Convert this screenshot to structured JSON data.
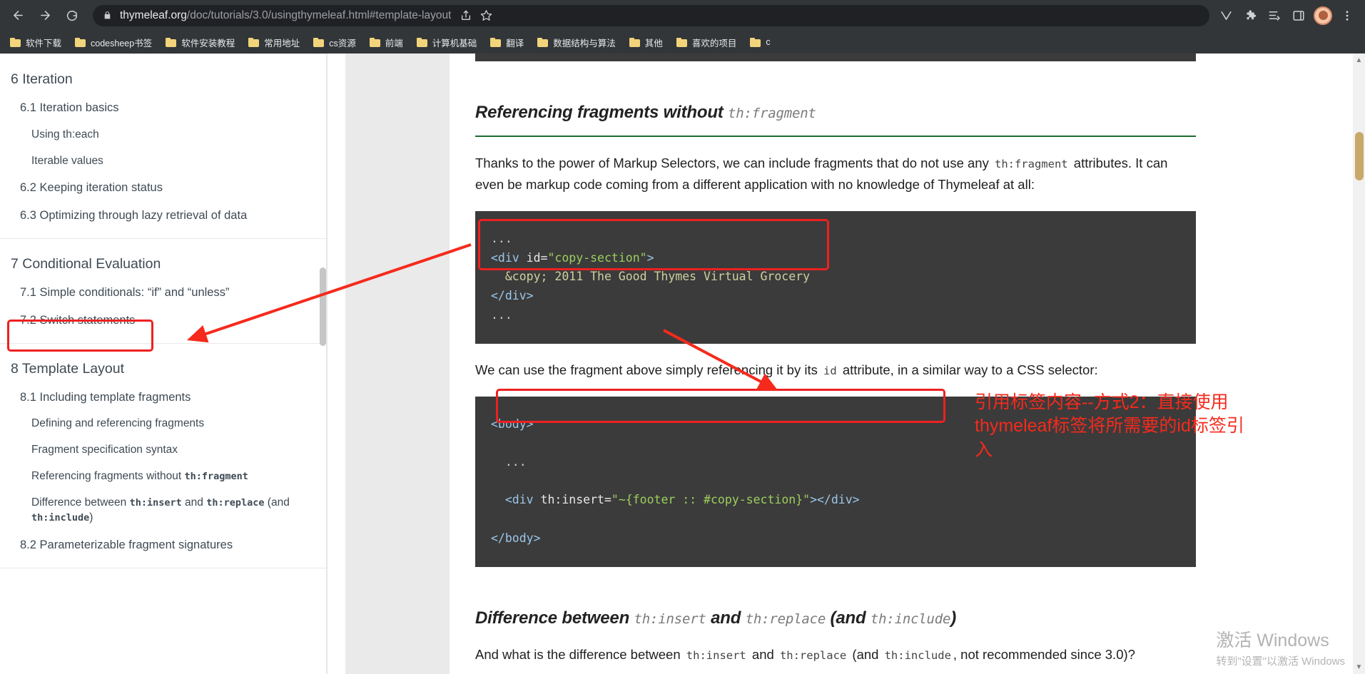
{
  "browser": {
    "back_icon": "back-arrow-icon",
    "forward_icon": "forward-arrow-icon",
    "reload_icon": "reload-icon",
    "lock_icon": "lock-icon",
    "url_host": "thymeleaf.org",
    "url_path": "/doc/tutorials/3.0/usingthymeleaf.html#template-layout",
    "share_icon": "share-icon",
    "bookmark_star_icon": "star-icon",
    "extension_icons": [
      "v-badge-icon",
      "puzzle-extension-icon",
      "reading-list-icon",
      "sidepanel-icon"
    ],
    "menu_icon": "three-dot-menu-icon",
    "avatar": "profile-avatar"
  },
  "bookmarks": [
    {
      "label": "软件下载"
    },
    {
      "label": "codesheep书签"
    },
    {
      "label": "软件安装教程"
    },
    {
      "label": "常用地址"
    },
    {
      "label": "cs资源"
    },
    {
      "label": "前端"
    },
    {
      "label": "计算机基础"
    },
    {
      "label": "翻译"
    },
    {
      "label": "数据结构与算法"
    },
    {
      "label": "其他"
    },
    {
      "label": "喜欢的项目"
    },
    {
      "label": "c"
    }
  ],
  "sidebar": {
    "groups": [
      {
        "items": [
          {
            "label": "6 Iteration",
            "level": 1
          },
          {
            "label": "6.1 Iteration basics",
            "level": 2
          },
          {
            "label": "Using th:each",
            "level": 3
          },
          {
            "label": "Iterable values",
            "level": 3
          },
          {
            "label": "6.2 Keeping iteration status",
            "level": 2
          },
          {
            "label": "6.3 Optimizing through lazy retrieval of data",
            "level": 2
          }
        ]
      },
      {
        "items": [
          {
            "label": "7 Conditional Evaluation",
            "level": 1
          },
          {
            "label": "7.1 Simple conditionals: “if” and “unless”",
            "level": 2
          },
          {
            "label": "7.2 Switch statements",
            "level": 2
          }
        ]
      },
      {
        "items": [
          {
            "label": "8 Template Layout",
            "level": 1,
            "highlighted": true
          },
          {
            "label": "8.1 Including template fragments",
            "level": 2
          },
          {
            "label": "Defining and referencing fragments",
            "level": 3
          },
          {
            "label": "Fragment specification syntax",
            "level": 3
          },
          {
            "label": "Referencing fragments without th:fragment",
            "level": 3,
            "code_tail": "th:fragment"
          },
          {
            "label": "Difference between th:insert and th:replace (and th:include)",
            "level": 3
          },
          {
            "label": "8.2 Parameterizable fragment signatures",
            "level": 2
          }
        ]
      }
    ]
  },
  "content": {
    "heading_text": "Referencing fragments without ",
    "heading_code": "th:fragment",
    "paragraph1_a": "Thanks to the power of Markup Selectors, we can include fragments that do not use any ",
    "paragraph1_code": "th:fragment",
    "paragraph1_b": " attributes. It can even be markup code coming from a different application with no knowledge of Thymeleaf at all:",
    "code_block_1": {
      "line0": "...",
      "line1_tag_open": "<div",
      "line1_attr": " id=",
      "line1_value": "\"copy-section\"",
      "line1_close": ">",
      "line2": "  &copy; 2011 The Good Thymes Virtual Grocery",
      "line3": "</div>",
      "line4": "..."
    },
    "paragraph2_a": "We can use the fragment above simply referencing it by its ",
    "paragraph2_code": "id",
    "paragraph2_b": " attribute, in a similar way to a CSS selector:",
    "code_block_2": {
      "line1": "<body>",
      "line2": "...",
      "line3_open": "<div",
      "line3_attr": " th:insert=",
      "line3_value": "\"~{footer :: #copy-section}\"",
      "line3_close": "></div>",
      "line4": "</body>"
    },
    "heading2_a": "Difference between ",
    "heading2_code1": "th:insert",
    "heading2_b": " and ",
    "heading2_code2": "th:replace",
    "heading2_c": " (and ",
    "heading2_code3": "th:include",
    "heading2_d": ")",
    "paragraph3_a": "And what is the difference between ",
    "paragraph3_code1": "th:insert",
    "paragraph3_b": " and ",
    "paragraph3_code2": "th:replace",
    "paragraph3_c": " (and ",
    "paragraph3_code3": "th:include",
    "paragraph3_d": ", not recommended since 3.0)?"
  },
  "annotations": {
    "note_line1": "引用标签内容--方式2：直接使用",
    "note_line2": "thymeleaf标签将所需要的id标签引",
    "note_line3": "入",
    "accent_color": "#f52a1c"
  },
  "watermark": {
    "line1": "激活 Windows",
    "line2": "转到\"设置\"以激活 Windows"
  }
}
